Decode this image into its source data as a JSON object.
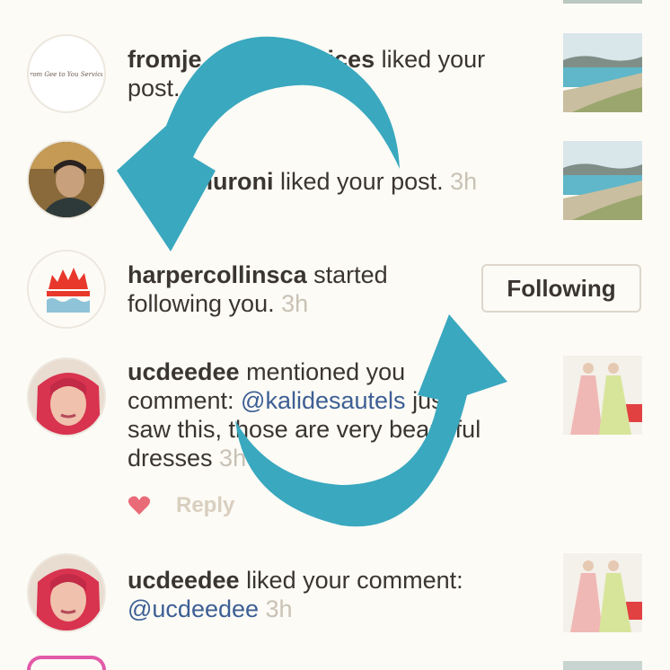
{
  "notifications": [
    {
      "username": "fromje",
      "username_tail": "vices",
      "action": " liked your",
      "action2": "post."
    },
    {
      "username": "emuroni",
      "action": " liked your post. ",
      "time": "3h"
    },
    {
      "username": "harpercollinsca",
      "action": " started",
      "action2": "following you. ",
      "time": "3h",
      "button_label": "Following"
    },
    {
      "username": "ucdeedee",
      "action": " mentioned you",
      "line2_prefix": "comment: ",
      "mention": "@kalidesautels",
      "line2_suffix": " just",
      "line3": "saw this, those are very beautiful",
      "line4": "dresses ",
      "time": "3h",
      "reply_label": "Reply"
    },
    {
      "username": "ucdeedee",
      "action": " liked your comment:",
      "mention": "@ucdeedee",
      "time": " 3h"
    }
  ],
  "avatar_logo_text": "From Gee to You Services",
  "colors": {
    "accent_arrow": "#3aa8bf",
    "like_heart": "#e96b78",
    "mention": "#3d5f94",
    "timestamp": "#c9c2b5"
  },
  "icons": [
    "refresh-arrows-icon",
    "heart-icon"
  ]
}
